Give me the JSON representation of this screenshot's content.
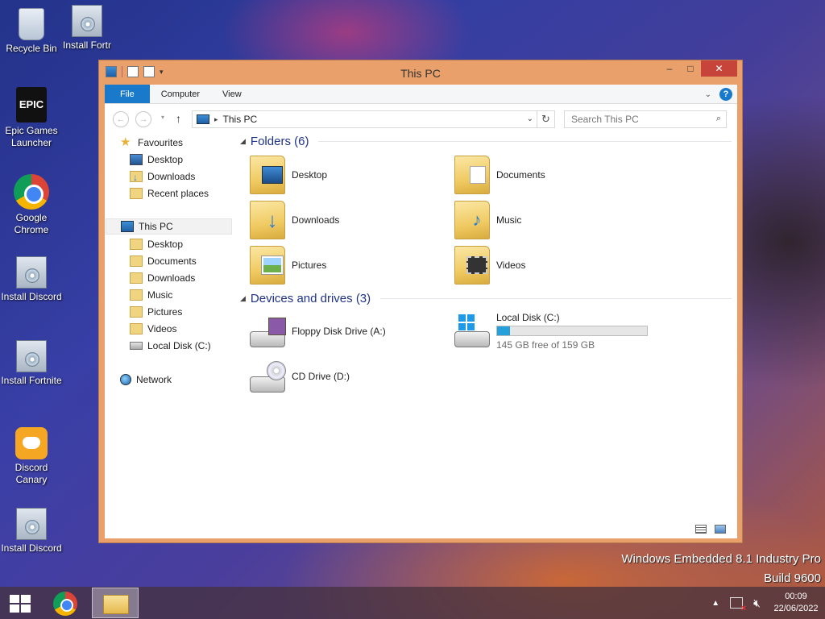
{
  "desktop": {
    "icons": [
      {
        "label": "Recycle Bin"
      },
      {
        "label": "Install Fortn"
      },
      {
        "label": "Epic Games Launcher"
      },
      {
        "label": "Google Chrome"
      },
      {
        "label": "Install Discord"
      },
      {
        "label": "Install Fortnite"
      },
      {
        "label": "Discord Canary"
      },
      {
        "label": "Install Discord"
      }
    ],
    "epic_logo_text": "EPIC",
    "watermark_line1": "Windows Embedded 8.1 Industry Pro",
    "watermark_line2": "Build 9600"
  },
  "window": {
    "title": "This PC",
    "minimize": "–",
    "maximize": "□",
    "close": "✕",
    "ribbon_tabs": [
      "File",
      "Computer",
      "View"
    ],
    "help": "?",
    "address": "This PC",
    "search_placeholder": "Search This PC"
  },
  "nav": {
    "favourites": "Favourites",
    "fav_items": [
      "Desktop",
      "Downloads",
      "Recent places"
    ],
    "this_pc": "This PC",
    "pc_items": [
      "Desktop",
      "Documents",
      "Downloads",
      "Music",
      "Pictures",
      "Videos",
      "Local Disk (C:)"
    ],
    "network": "Network"
  },
  "content": {
    "folders_header": "Folders (6)",
    "folders": [
      "Desktop",
      "Documents",
      "Downloads",
      "Music",
      "Pictures",
      "Videos"
    ],
    "devices_header": "Devices and drives (3)",
    "floppy": "Floppy Disk Drive (A:)",
    "local_disk": {
      "name": "Local Disk (C:)",
      "free_text": "145 GB free of 159 GB",
      "used_fraction": 0.088
    },
    "cd": "CD Drive (D:)"
  },
  "taskbar": {
    "time": "00:09",
    "date": "22/06/2022",
    "tray_arrow": "▲"
  },
  "colors": {
    "window_frame": "#e9a06a",
    "accent": "#1979ca",
    "group_header": "#1e3287",
    "bar_fill": "#26a0da"
  }
}
